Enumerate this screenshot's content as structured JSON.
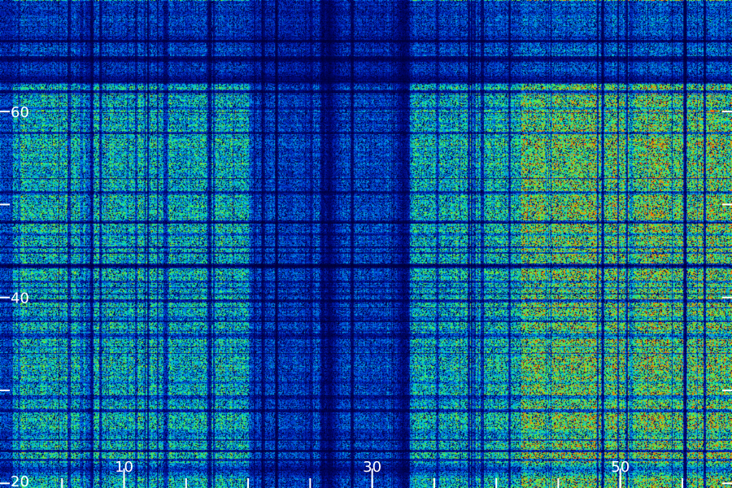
{
  "chart_data": {
    "type": "heatmap",
    "title": "",
    "xlabel": "",
    "ylabel": "",
    "xlim": [
      0,
      59
    ],
    "ylim": [
      19.5,
      72
    ],
    "x_major_ticks": [
      10,
      30,
      50
    ],
    "x_major_tick_labels": [
      "10",
      "30",
      "50"
    ],
    "x_minor_ticks": [
      5,
      10,
      15,
      20,
      25,
      30,
      35,
      40,
      45,
      50,
      55
    ],
    "y_ticks": [
      20,
      30,
      40,
      50,
      60
    ],
    "y_tick_labels": [
      "20",
      "",
      "40",
      "",
      "60"
    ],
    "grid": false,
    "colormap": [
      "#000033",
      "#000a80",
      "#0033cc",
      "#0080e6",
      "#00ccd9",
      "#1aeb80",
      "#66f233",
      "#b3d91a",
      "#e6a000",
      "#ff5500"
    ],
    "column_bands": [
      {
        "x_range": [
          1,
          20
        ],
        "level": 0.55
      },
      {
        "x_range": [
          20,
          33
        ],
        "level": 0.3
      },
      {
        "x_range": [
          33,
          42
        ],
        "level": 0.55
      },
      {
        "x_range": [
          42,
          59
        ],
        "level": 0.78
      }
    ],
    "row_bands": [
      {
        "y_range": [
          19.5,
          63
        ],
        "level": 0.55
      },
      {
        "y_range": [
          63,
          72
        ],
        "level": 0.15
      }
    ],
    "dark_streaks_x": [
      26.5,
      32.5
    ],
    "dark_streaks_y": [
      21.5,
      63.5
    ]
  }
}
